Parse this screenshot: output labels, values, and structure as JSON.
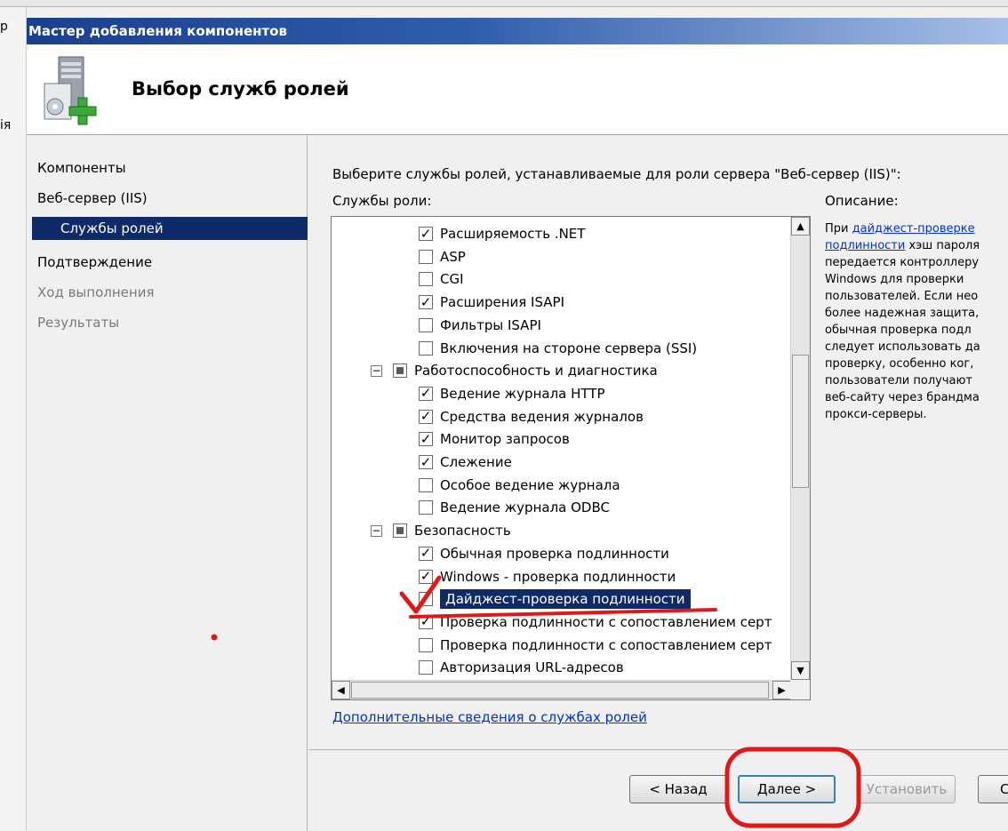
{
  "window": {
    "title": "Мастер добавления компонентов"
  },
  "background_fragments": {
    "title_fragment": "р",
    "label_fragment": "ія"
  },
  "header": {
    "title": "Выбор служб ролей",
    "icon": "server-add-icon"
  },
  "nav": {
    "items": [
      {
        "label": "Компоненты",
        "state": "normal"
      },
      {
        "label": "Веб-сервер (IIS)",
        "state": "normal"
      },
      {
        "label": "Службы ролей",
        "state": "selected"
      },
      {
        "label": "Подтверждение",
        "state": "normal"
      },
      {
        "label": "Ход выполнения",
        "state": "disabled"
      },
      {
        "label": "Результаты",
        "state": "disabled"
      }
    ]
  },
  "content": {
    "prompt": "Выберите службы ролей, устанавливаемые для роли сервера \"Веб-сервер (IIS)\":",
    "services_label": "Службы роли:",
    "description_label": "Описание:"
  },
  "tree": {
    "items": [
      {
        "label": "Расширяемость .NET",
        "checked": true
      },
      {
        "label": "ASP",
        "checked": false
      },
      {
        "label": "CGI",
        "checked": false
      },
      {
        "label": "Расширения ISAPI",
        "checked": true
      },
      {
        "label": "Фильтры ISAPI",
        "checked": false
      },
      {
        "label": "Включения на стороне сервера (SSI)",
        "checked": false
      },
      {
        "label": "Работоспособность и диагностика",
        "checked": "partial",
        "group": true,
        "expander": "⊟"
      },
      {
        "label": "Ведение журнала HTTP",
        "checked": true
      },
      {
        "label": "Средства ведения журналов",
        "checked": true
      },
      {
        "label": "Монитор запросов",
        "checked": true
      },
      {
        "label": "Слежение",
        "checked": true
      },
      {
        "label": "Особое ведение журнала",
        "checked": false
      },
      {
        "label": "Ведение журнала ODBC",
        "checked": false
      },
      {
        "label": "Безопасность",
        "checked": "partial",
        "group": true,
        "expander": "⊟"
      },
      {
        "label": "Обычная проверка подлинности",
        "checked": true
      },
      {
        "label": "Windows - проверка подлинности",
        "checked": true
      },
      {
        "label": "Дайджест-проверка подлинности",
        "checked": true,
        "highlighted": true
      },
      {
        "label": "Проверка подлинности с сопоставлением серт",
        "checked": true
      },
      {
        "label": "Проверка подлинности с сопоставлением серт",
        "checked": false
      },
      {
        "label": "Авторизация URL-адресов",
        "checked": false
      }
    ]
  },
  "description": {
    "lines": [
      {
        "pre": "При ",
        "link": "дайджест-проверке"
      },
      {
        "link": "подлинности",
        "post": " хэш пароля"
      },
      {
        "pre": "передается контроллеру"
      },
      {
        "pre": "Windows для проверки"
      },
      {
        "pre": "пользователей. Если нео"
      },
      {
        "pre": "более надежная защита,"
      },
      {
        "pre": "обычная проверка подл"
      },
      {
        "pre": "следует использовать да"
      },
      {
        "pre": "проверку, особенно ког,"
      },
      {
        "pre": "пользователи получают"
      },
      {
        "pre": "веб-сайту через брандма"
      },
      {
        "pre": "прокси-серверы."
      }
    ]
  },
  "more_info_link": "Дополнительные сведения о службах ролей",
  "buttons": {
    "back": "< Назад",
    "next": "Далее >",
    "install": "Установить",
    "cancel_fragment": "С"
  },
  "annotation_colors": {
    "marker": "#e01818"
  }
}
